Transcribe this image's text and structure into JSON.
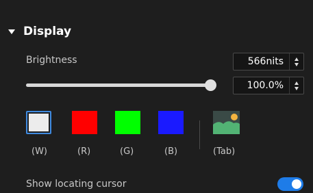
{
  "section": {
    "title": "Display"
  },
  "brightness": {
    "label": "Brightness",
    "nits_value": "566nits",
    "percent_value": "100.0%",
    "slider_level_percent": 100
  },
  "colors": {
    "swatches": [
      {
        "label": "(W)",
        "color": "#ececec",
        "selected": true
      },
      {
        "label": "(R)",
        "color": "#ff0000",
        "selected": false
      },
      {
        "label": "(G)",
        "color": "#00ff00",
        "selected": false
      },
      {
        "label": "(B)",
        "color": "#1a1aff",
        "selected": false
      }
    ],
    "image_label": "(Tab)"
  },
  "locating_cursor": {
    "label": "Show locating cursor",
    "enabled": true
  },
  "accent_color": "#1e7ce8"
}
